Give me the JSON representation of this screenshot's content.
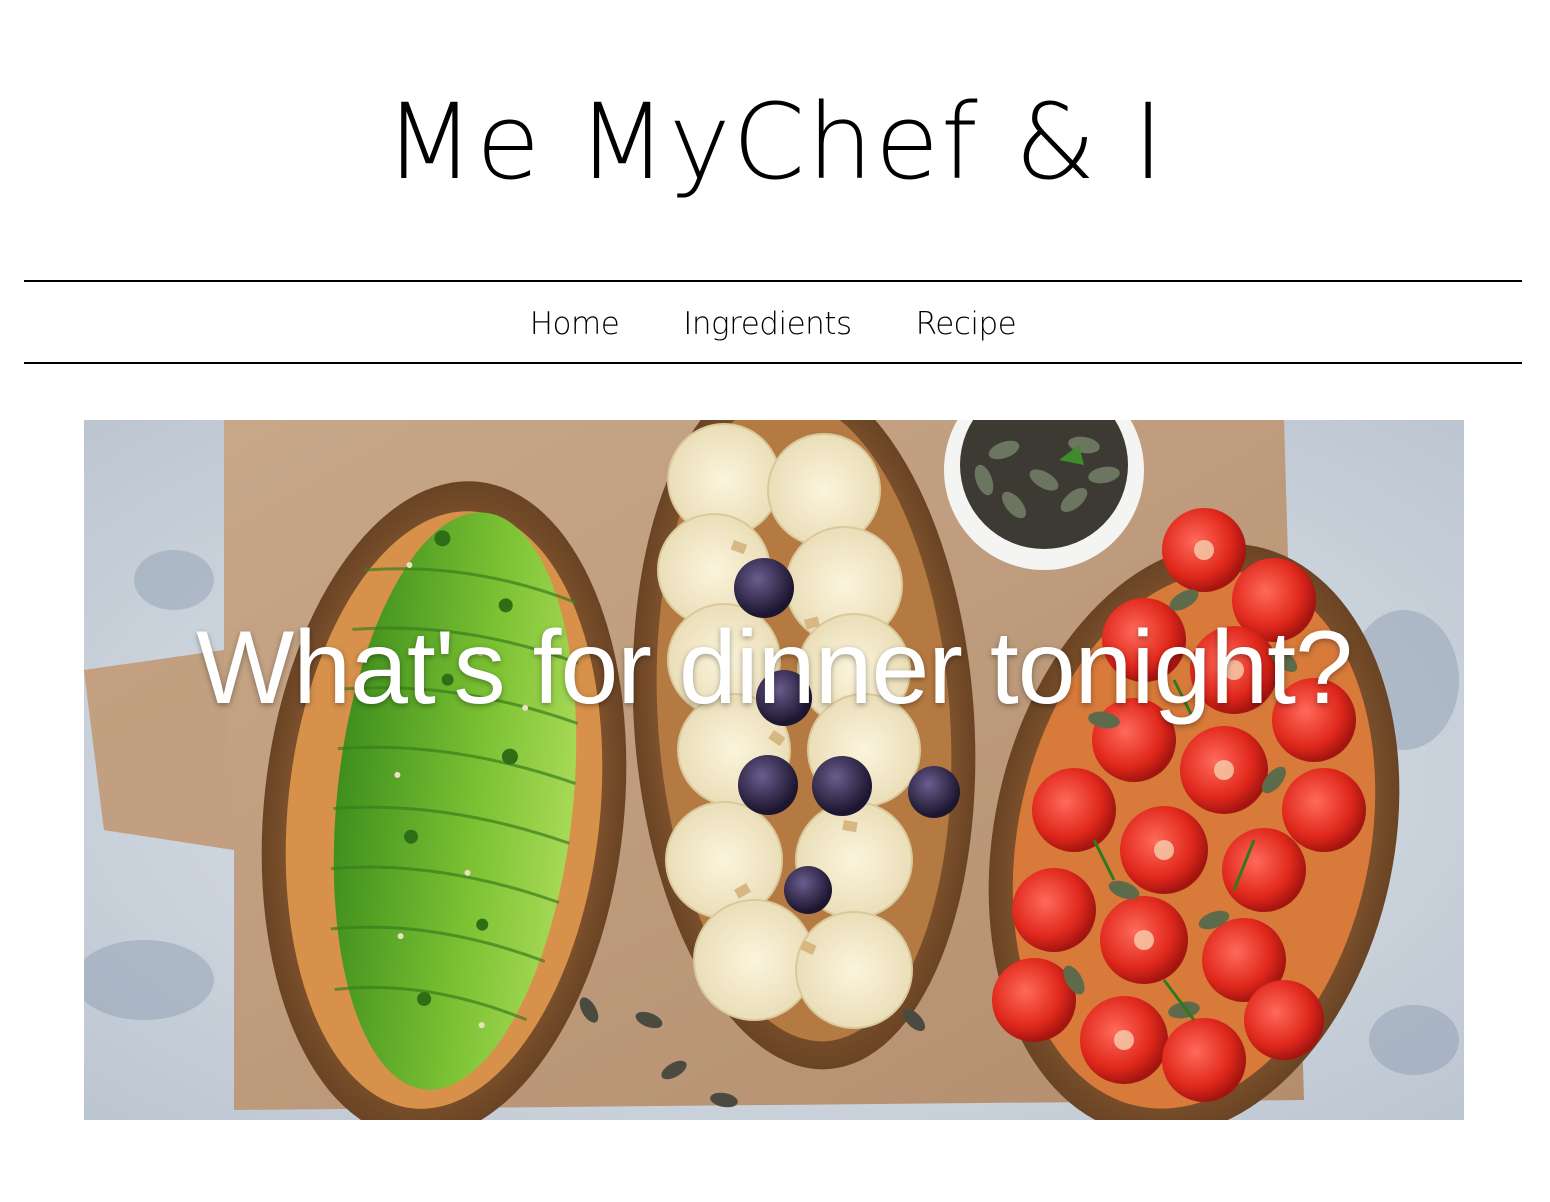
{
  "site": {
    "title": "Me MyChef & I"
  },
  "nav": {
    "items": [
      {
        "label": "Home"
      },
      {
        "label": "Ingredients"
      },
      {
        "label": "Recipe"
      }
    ]
  },
  "hero": {
    "headline": "What's for dinner tonight?",
    "image_subject": "three-toasts-avocado-banana-tomato"
  },
  "colors": {
    "text": "#000000",
    "background": "#ffffff",
    "hero_text": "#ffffff",
    "rule": "#000000"
  }
}
